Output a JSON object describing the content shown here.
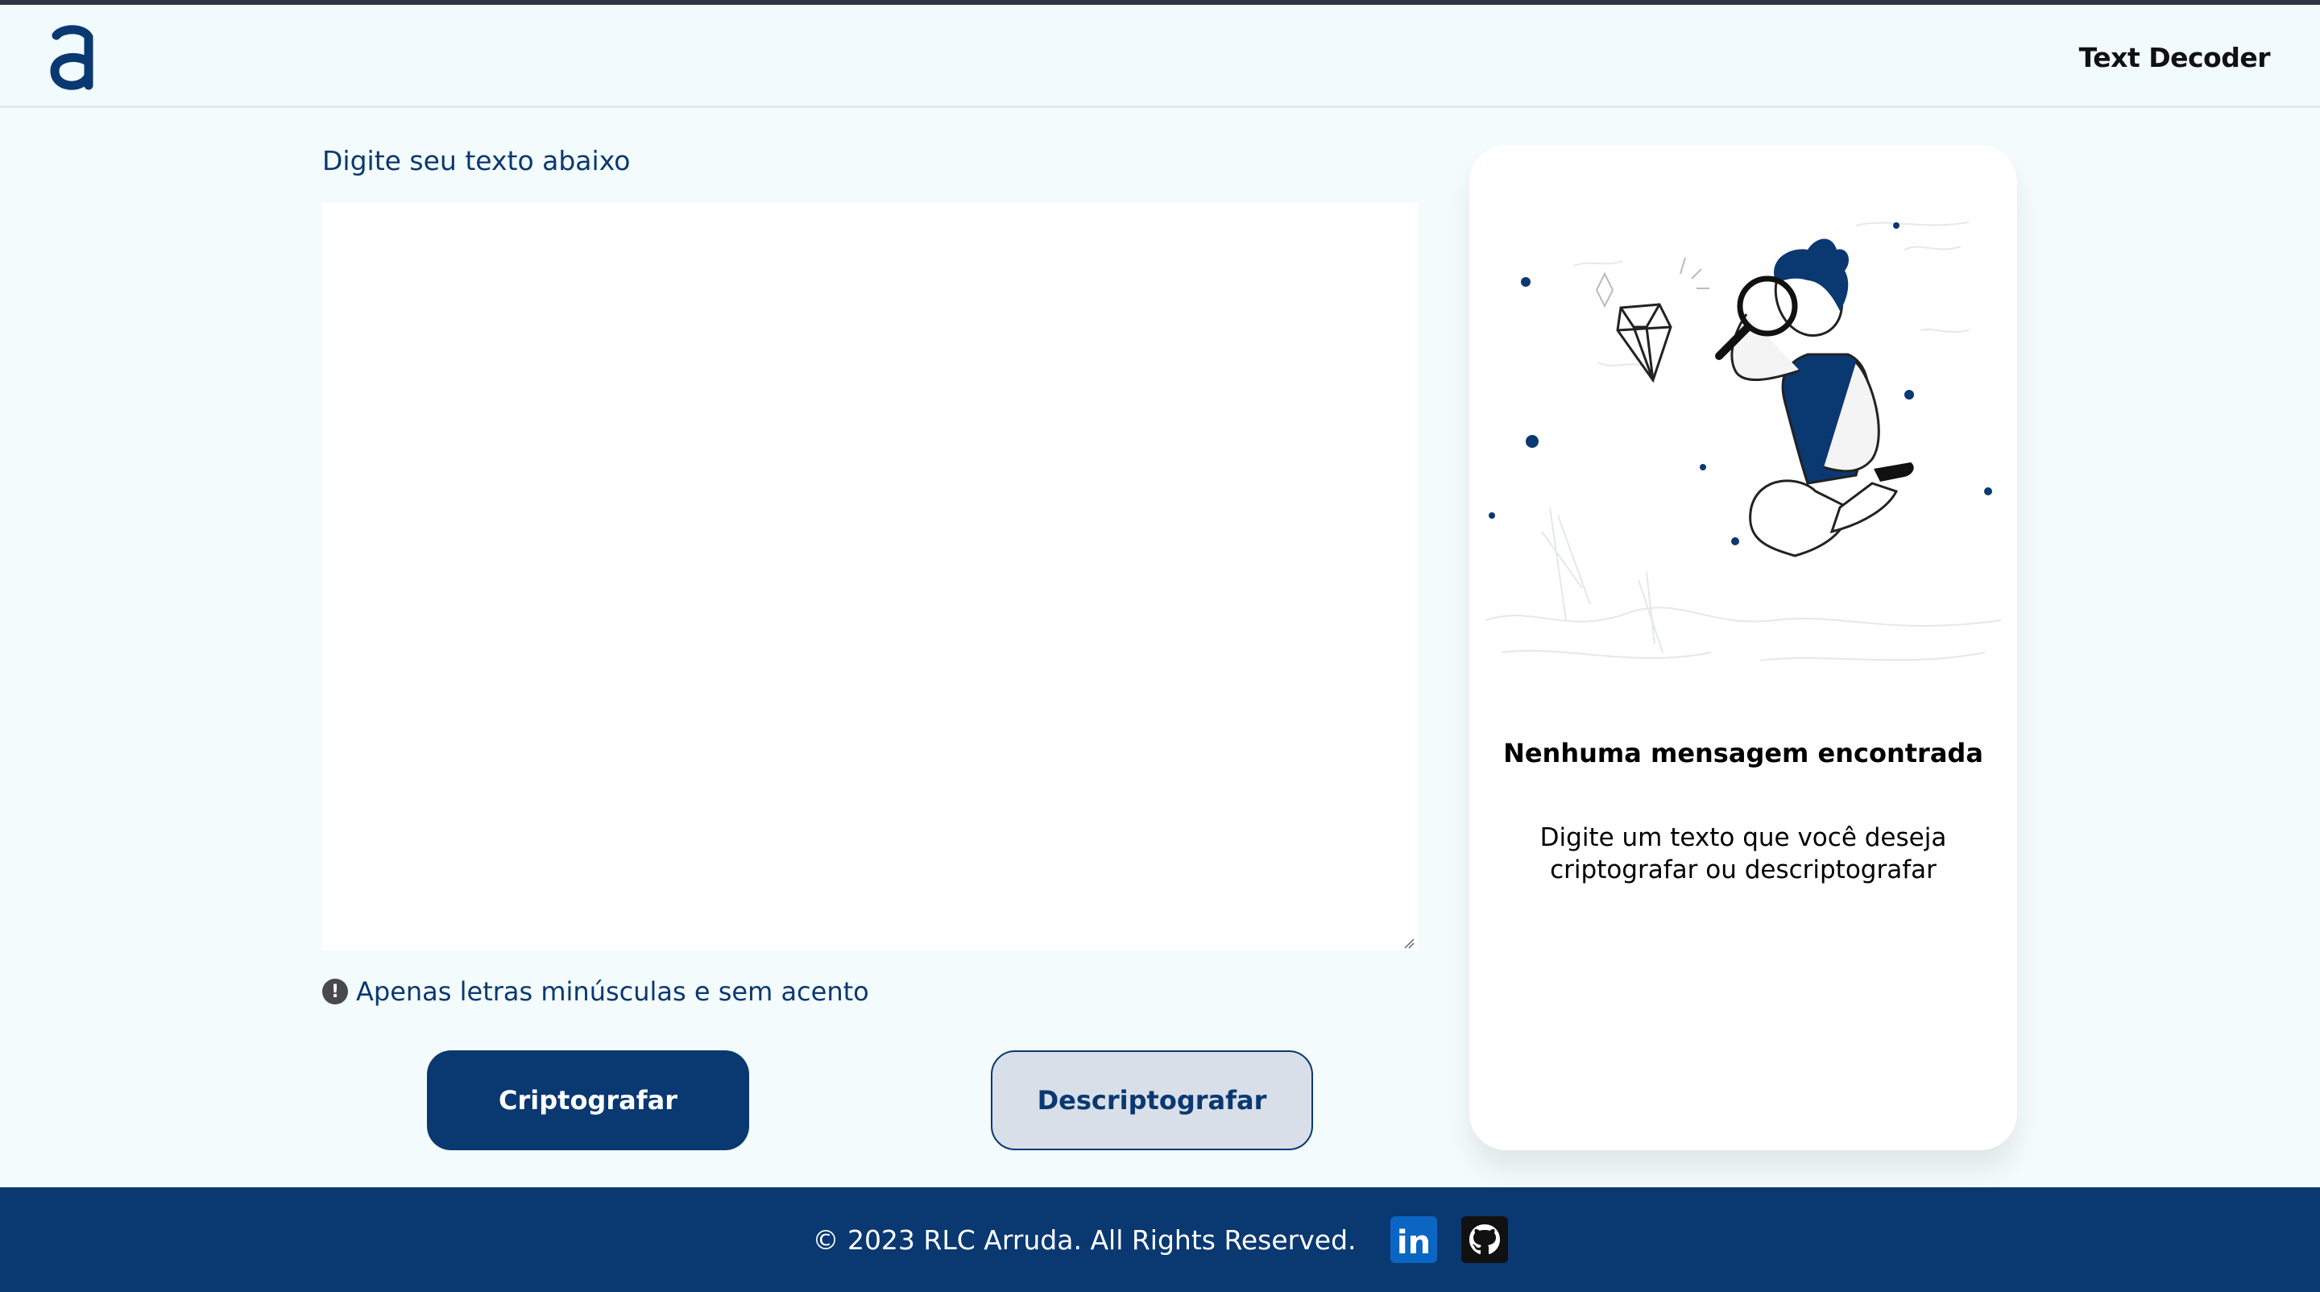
{
  "header": {
    "logo_icon": "alura-a-logo",
    "title": "Text Decoder"
  },
  "main": {
    "input_label": "Digite seu texto abaixo",
    "textarea": {
      "value": "",
      "placeholder": ""
    },
    "hint": {
      "icon": "exclamation-circle-icon",
      "text": "Apenas letras minúsculas e sem acento"
    },
    "buttons": {
      "encrypt": "Criptografar",
      "decrypt": "Descriptografar"
    }
  },
  "output_panel": {
    "illustration": "person-with-magnifying-glass-and-diamond",
    "title": "Nenhuma mensagem encontrada",
    "text": "Digite um texto que você deseja criptografar ou descriptografar"
  },
  "footer": {
    "copyright": "© 2023 RLC Arruda. All Rights Reserved.",
    "links": [
      {
        "icon": "linkedin-icon",
        "label": "in"
      },
      {
        "icon": "github-icon"
      }
    ]
  },
  "colors": {
    "primary": "#0a3871",
    "background": "#f3fbfc",
    "panel": "#ffffff",
    "decrypt_button": "#d8dfe8"
  }
}
